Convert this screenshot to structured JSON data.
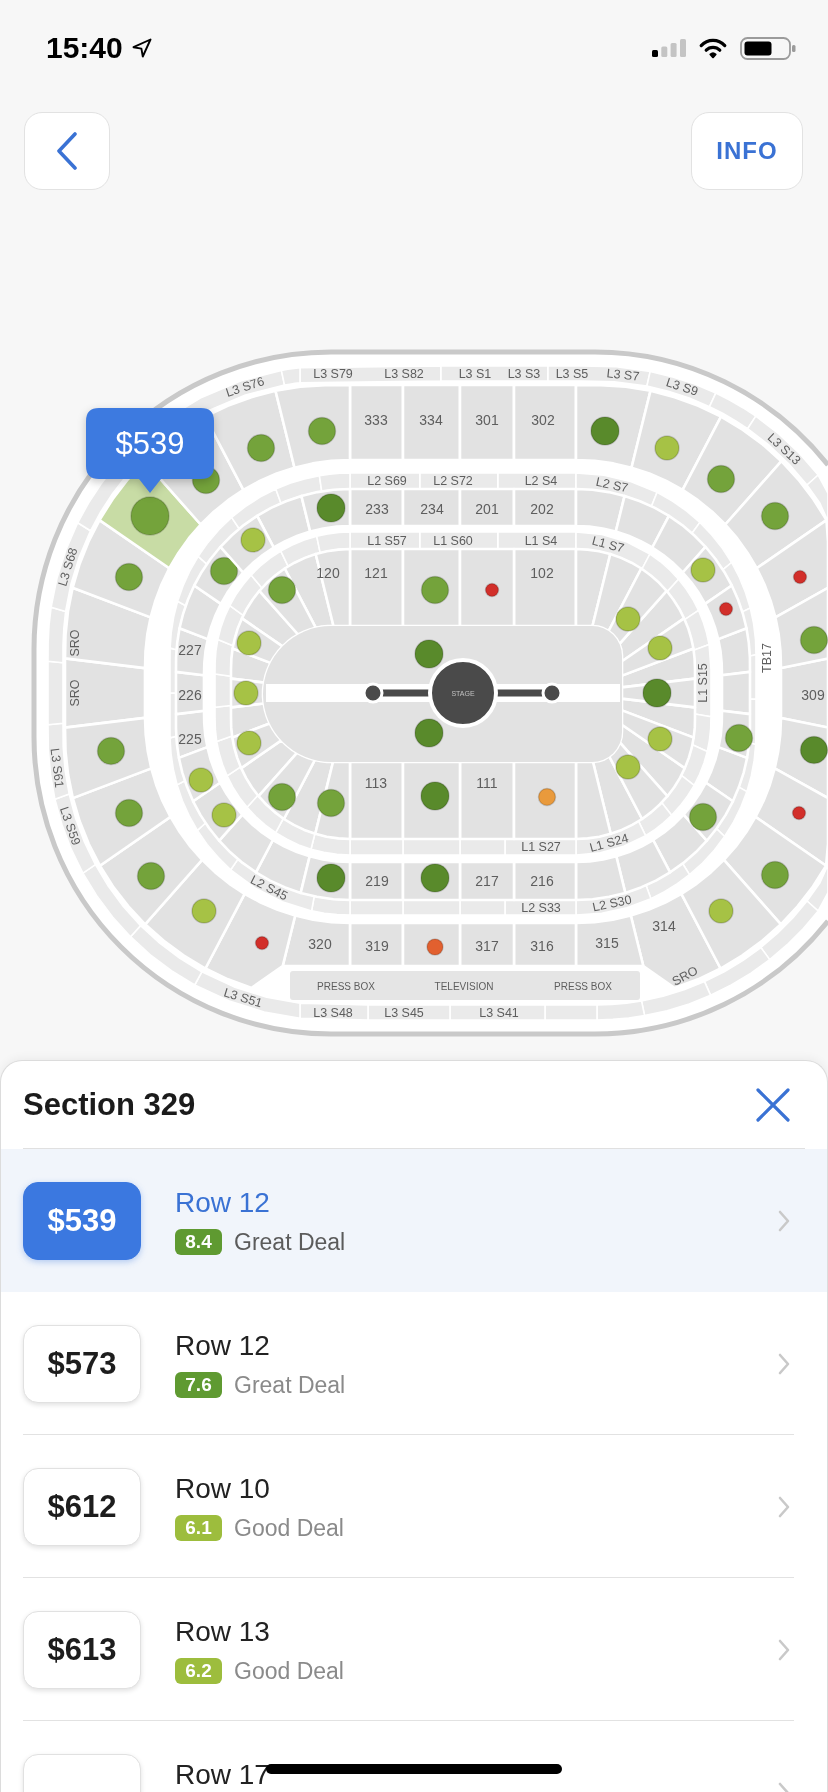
{
  "status_bar": {
    "time": "15:40"
  },
  "header": {
    "info_button": "INFO"
  },
  "map": {
    "labels": [
      "L3 S76",
      "L3 S79",
      "L3 S82",
      "L3 S1",
      "L3 S3",
      "L3 S5",
      "L3 S7",
      "L3 S9",
      "333",
      "334",
      "301",
      "302",
      "L3 S13",
      "L2 S69",
      "L2 S72",
      "L2 S4",
      "L2 S7",
      "233",
      "234",
      "201",
      "202",
      "L1 S57",
      "L1 S60",
      "L1 S4",
      "L1 S7",
      "L3 S68",
      "120",
      "121",
      "102",
      "SRO",
      "227",
      "TB17",
      "SRO",
      "226",
      "L1 S15",
      "309",
      "225",
      "L3 S61",
      "113",
      "111",
      "L3 S59",
      "L1 S27",
      "L1 S24",
      "L2 S45",
      "219",
      "217",
      "216",
      "L2 S33",
      "L2 S30",
      "314",
      "320",
      "319",
      "317",
      "316",
      "315",
      "L3 S51",
      "PRESS BOX",
      "TELEVISION",
      "PRESS BOX",
      "SRO",
      "L3 S48",
      "L3 S45",
      "L3 S41"
    ],
    "stage_label": "STAGE",
    "markers": [
      {
        "color": "#598a2b",
        "selected": false
      },
      {
        "color": "#74a33b",
        "selected": false
      },
      {
        "color": "#74a33b",
        "selected": false
      },
      {
        "color": "#a6c245",
        "selected": false
      },
      {
        "color": "#74a33b",
        "selected": false
      },
      {
        "color": "#74a33b",
        "selected": false
      },
      {
        "color": "#598a2b",
        "selected": false
      },
      {
        "color": "#74a33b",
        "selected": true
      },
      {
        "color": "#74a33b",
        "selected": false
      },
      {
        "color": "#a6c245",
        "selected": false
      },
      {
        "color": "#a6c245",
        "selected": false
      },
      {
        "color": "#74a33b",
        "selected": false
      },
      {
        "color": "#74a33b",
        "selected": false
      },
      {
        "color": "#d22f2a",
        "selected": false
      },
      {
        "color": "#74a33b",
        "selected": false
      },
      {
        "color": "#74a33b",
        "selected": false
      },
      {
        "color": "#d22f2a",
        "selected": false
      },
      {
        "color": "#d22f2a",
        "selected": false
      },
      {
        "color": "#a6c245",
        "selected": false
      },
      {
        "color": "#74a33b",
        "selected": false
      },
      {
        "color": "#a6c245",
        "selected": false
      },
      {
        "color": "#a6c245",
        "selected": false
      },
      {
        "color": "#598a2b",
        "selected": false
      },
      {
        "color": "#a6c245",
        "selected": false
      },
      {
        "color": "#598a2b",
        "selected": false
      },
      {
        "color": "#598a2b",
        "selected": false
      },
      {
        "color": "#a6c245",
        "selected": false
      },
      {
        "color": "#74a33b",
        "selected": false
      },
      {
        "color": "#a6c245",
        "selected": false
      },
      {
        "color": "#598a2b",
        "selected": false
      },
      {
        "color": "#74a33b",
        "selected": false
      },
      {
        "color": "#a6c245",
        "selected": false
      },
      {
        "color": "#a6c245",
        "selected": false
      },
      {
        "color": "#e99a3c",
        "selected": false
      },
      {
        "color": "#74a33b",
        "selected": false
      },
      {
        "color": "#74a33b",
        "selected": false
      },
      {
        "color": "#598a2b",
        "selected": false
      },
      {
        "color": "#d22f2a",
        "selected": false
      },
      {
        "color": "#74a33b",
        "selected": false
      },
      {
        "color": "#a6c245",
        "selected": false
      },
      {
        "color": "#74a33b",
        "selected": false
      },
      {
        "color": "#74a33b",
        "selected": false
      },
      {
        "color": "#74a33b",
        "selected": false
      },
      {
        "color": "#598a2b",
        "selected": false
      },
      {
        "color": "#598a2b",
        "selected": false
      },
      {
        "color": "#a6c245",
        "selected": false
      },
      {
        "color": "#a6c245",
        "selected": false
      },
      {
        "color": "#d22f2a",
        "selected": false
      },
      {
        "color": "#e2602f",
        "selected": false
      }
    ],
    "callout": "$539"
  },
  "sheet": {
    "title": "Section 329",
    "listings": [
      {
        "price": "$539",
        "row": "Row 12",
        "score": "8.4",
        "color": "#5f9a31",
        "deal": "Great Deal",
        "selected": true
      },
      {
        "price": "$573",
        "row": "Row 12",
        "score": "7.6",
        "color": "#5f9a31",
        "deal": "Great Deal",
        "selected": false
      },
      {
        "price": "$612",
        "row": "Row 10",
        "score": "6.1",
        "color": "#9dbd3d",
        "deal": "Good Deal",
        "selected": false
      },
      {
        "price": "$613",
        "row": "Row 13",
        "score": "6.2",
        "color": "#9dbd3d",
        "deal": "Good Deal",
        "selected": false
      },
      {
        "row": "Row 17",
        "selected": false
      }
    ]
  }
}
